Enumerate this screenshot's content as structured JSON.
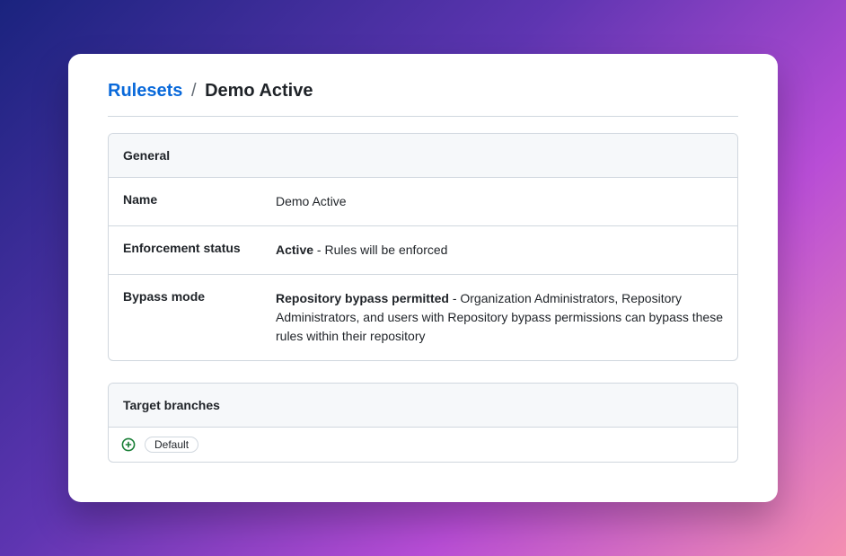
{
  "breadcrumb": {
    "root": "Rulesets",
    "separator": "/",
    "current": "Demo Active"
  },
  "general": {
    "header": "General",
    "rows": {
      "name": {
        "label": "Name",
        "value": "Demo Active"
      },
      "enforcement": {
        "label": "Enforcement status",
        "strong": "Active",
        "rest": " - Rules will be enforced"
      },
      "bypass": {
        "label": "Bypass mode",
        "strong": "Repository bypass permitted",
        "rest": " - Organization Administrators, Repository Administrators, and users with Repository bypass permissions can bypass these rules within their repository"
      }
    }
  },
  "targets": {
    "header": "Target branches",
    "items": [
      {
        "label": "Default"
      }
    ]
  }
}
